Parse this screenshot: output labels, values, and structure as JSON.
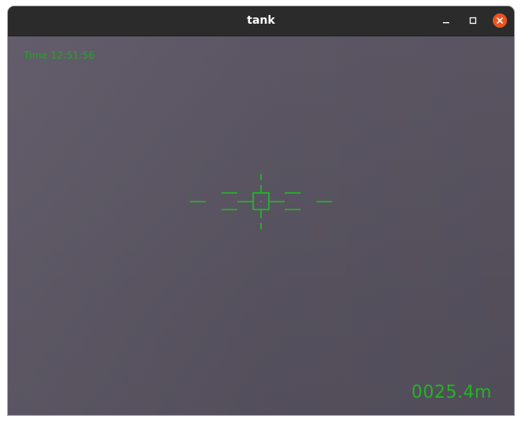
{
  "window": {
    "title": "tank",
    "controls": {
      "minimize_icon": "minimize-icon",
      "maximize_icon": "maximize-icon",
      "close_icon": "close-icon"
    },
    "close_color": "#e95420"
  },
  "hud": {
    "time_text": "Time 12:51:56",
    "distance_text": "0025.4m",
    "color": "#22b422",
    "crosshair": "crosshair-icon"
  }
}
